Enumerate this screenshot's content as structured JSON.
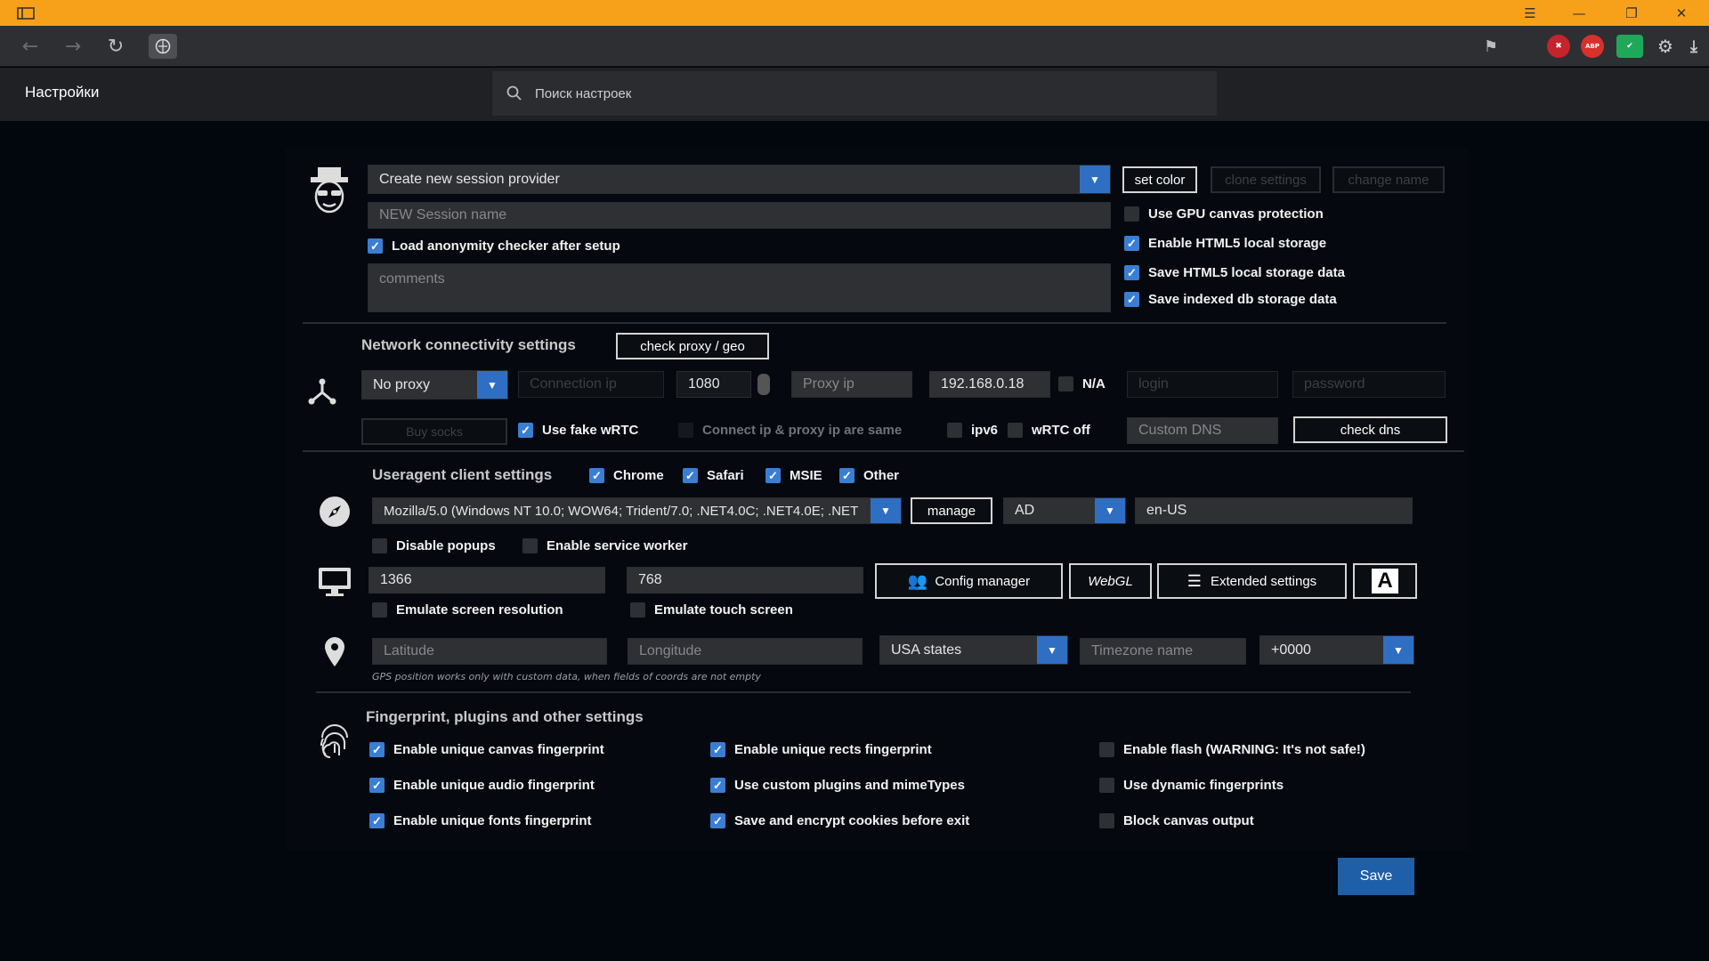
{
  "browser": {
    "settings_title": "Настройки",
    "search_placeholder": "Поиск настроек"
  },
  "session": {
    "provider": "Create new session provider",
    "name_placeholder": "NEW Session name",
    "load_checker": "Load anonymity checker after setup",
    "comments_placeholder": "comments",
    "set_color": "set color",
    "clone_settings": "clone settings",
    "change_name": "change name",
    "gpu_canvas": "Use GPU canvas protection",
    "html5_storage": "Enable HTML5 local storage",
    "save_html5": "Save HTML5 local storage data",
    "save_indexeddb": "Save indexed db storage data"
  },
  "network": {
    "title": "Network connectivity settings",
    "check_proxy": "check proxy / geo",
    "proxy_type": "No proxy",
    "connection_ip_placeholder": "Connection ip",
    "port": "1080",
    "proxy_ip_placeholder": "Proxy ip",
    "proxy_ip_value": "192.168.0.18",
    "na": "N/A",
    "login_placeholder": "login",
    "password_placeholder": "password",
    "buy_socks": "Buy socks",
    "fake_wrtc": "Use fake wRTC",
    "same_ip": "Connect ip & proxy ip are same",
    "ipv6": "ipv6",
    "wrtc_off": "wRTC off",
    "custom_dns_placeholder": "Custom DNS",
    "check_dns": "check dns"
  },
  "useragent": {
    "title": "Useragent client settings",
    "chrome": "Chrome",
    "safari": "Safari",
    "msie": "MSIE",
    "other": "Other",
    "ua_string": "Mozilla/5.0 (Windows NT 10.0; WOW64; Trident/7.0; .NET4.0C; .NET4.0E; .NET",
    "manage": "manage",
    "country": "AD",
    "language": "en-US",
    "disable_popups": "Disable popups",
    "service_worker": "Enable service worker"
  },
  "screen": {
    "width": "1366",
    "height": "768",
    "config_manager": "Config manager",
    "webgl": "WebGL",
    "extended_settings": "Extended settings",
    "font_button": "A",
    "emulate_resolution": "Emulate screen resolution",
    "emulate_touch": "Emulate touch screen"
  },
  "geo": {
    "latitude_placeholder": "Latitude",
    "longitude_placeholder": "Longitude",
    "states": "USA states",
    "timezone_placeholder": "Timezone name",
    "offset": "+0000",
    "note": "GPS position works only with custom data, when fields of coords are not empty"
  },
  "fingerprint": {
    "title": "Fingerprint, plugins and other settings",
    "canvas": "Enable unique canvas fingerprint",
    "audio": "Enable unique audio fingerprint",
    "fonts": "Enable unique fonts fingerprint",
    "rects": "Enable unique rects fingerprint",
    "plugins": "Use custom plugins and mimeTypes",
    "cookies": "Save and encrypt cookies before exit",
    "flash": "Enable flash (WARNING: It's not safe!)",
    "dynamic": "Use dynamic fingerprints",
    "block_canvas": "Block canvas output"
  },
  "save_label": "Save",
  "colors": {
    "titlebar": "#f7a11a",
    "accent": "#3a7ed4",
    "save": "#1f5fa8"
  }
}
